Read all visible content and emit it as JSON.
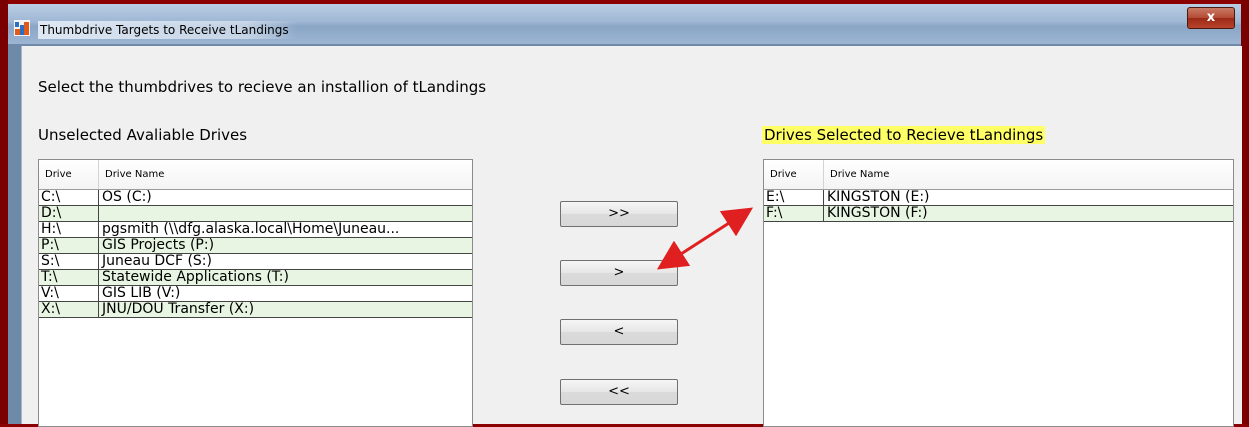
{
  "window": {
    "title": "Thumbdrive Targets to Receive tLandings",
    "close_label": "x"
  },
  "instruction": "Select the thumbdrives to recieve an installion of tLandings",
  "left_panel": {
    "label": "Unselected Avaliable Drives",
    "columns": [
      "Drive",
      "Drive Name"
    ],
    "rows": [
      {
        "drive": "C:\\",
        "name": "OS (C:)"
      },
      {
        "drive": "D:\\",
        "name": ""
      },
      {
        "drive": "H:\\",
        "name": "pgsmith (\\\\dfg.alaska.local\\Home\\Juneau..."
      },
      {
        "drive": "P:\\",
        "name": "GIS Projects (P:)"
      },
      {
        "drive": "S:\\",
        "name": "Juneau DCF (S:)"
      },
      {
        "drive": "T:\\",
        "name": "Statewide Applications (T:)"
      },
      {
        "drive": "V:\\",
        "name": "GIS LIB (V:)"
      },
      {
        "drive": "X:\\",
        "name": "JNU/DOU Transfer (X:)"
      }
    ]
  },
  "right_panel": {
    "label": "Drives Selected to Recieve tLandings",
    "columns": [
      "Drive",
      "Drive Name"
    ],
    "rows": [
      {
        "drive": "E:\\",
        "name": "KINGSTON (E:)"
      },
      {
        "drive": "F:\\",
        "name": "KINGSTON (F:)"
      }
    ]
  },
  "buttons": {
    "add_all": ">>",
    "add": ">",
    "remove": "<",
    "remove_all": "<<"
  },
  "colors": {
    "alt_row": "#e8f5e2",
    "highlight": "#ffff66",
    "annotation_arrow": "#e02020"
  }
}
